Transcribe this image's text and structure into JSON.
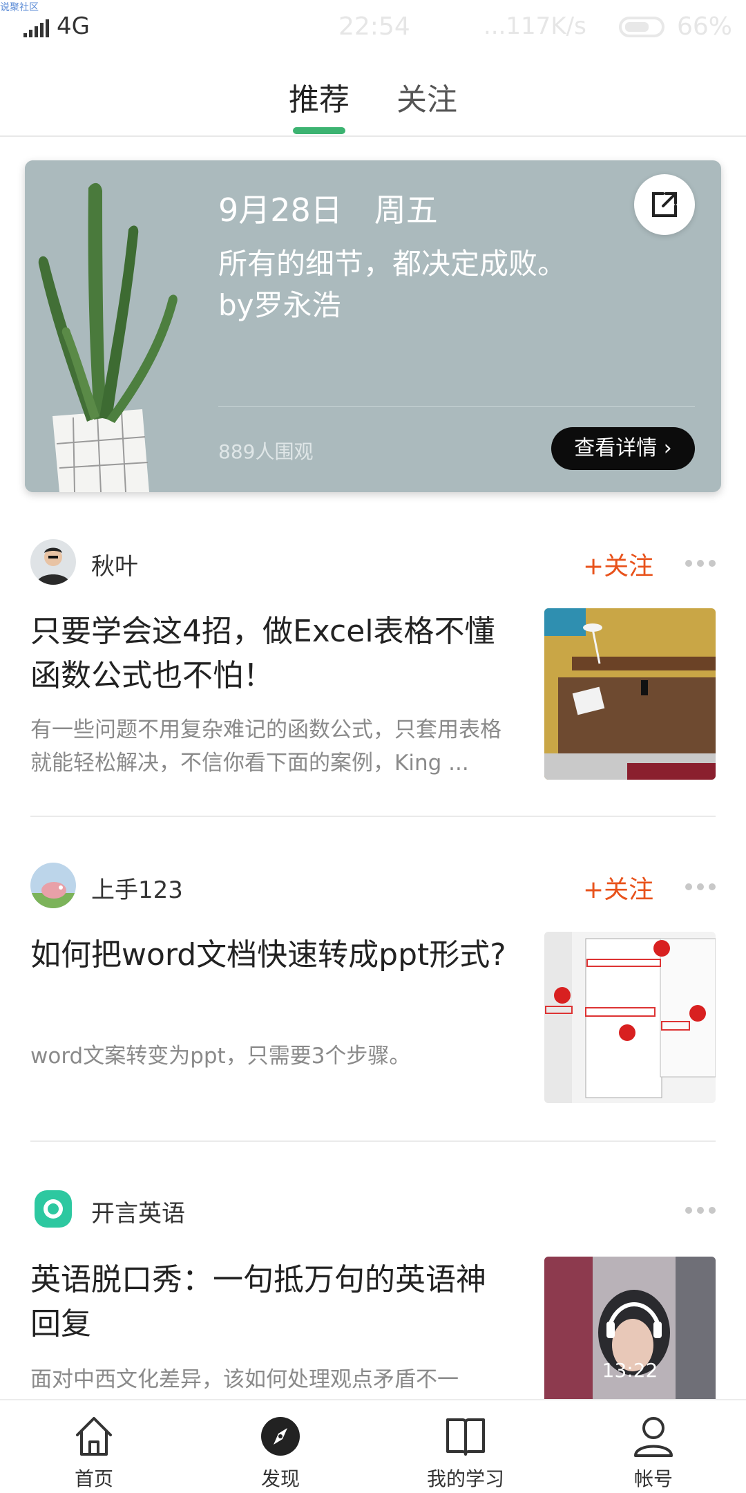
{
  "status_bar": {
    "watermark": "说聚社区",
    "network": "4G",
    "time": "22:54",
    "speed": "...117K/s",
    "battery": "66%",
    "battery_level": 0.66
  },
  "tabs": [
    {
      "label": "推荐",
      "active": true
    },
    {
      "label": "关注",
      "active": false
    }
  ],
  "quote_card": {
    "date": "9月28日　周五",
    "quote_line1": "所有的细节，都决定成败。",
    "quote_line2": "by罗永浩",
    "watchers": "889人围观",
    "detail_button": "查看详情",
    "background_color": "#abbabd"
  },
  "feed": [
    {
      "author": "秋叶",
      "follow_label": "+关注",
      "title": "只要学会这4招，做Excel表格不懂函数公式也不怕！",
      "summary": "有一些问题不用复杂难记的函数公式，只套用表格就能轻松解决，不信你看下面的案例，King ...",
      "thumbnail": "desk-photo"
    },
    {
      "author": "上手123",
      "follow_label": "+关注",
      "title": "如何把word文档快速转成ppt形式?",
      "summary": "word文案转变为ppt，只需要3个步骤。",
      "thumbnail": "screenshot-steps"
    },
    {
      "author": "开言英语",
      "title": "英语脱口秀：一句抵万句的英语神回复",
      "summary": "面对中西文化差异，该如何处理观点矛盾不一",
      "thumbnail": "audio-photo",
      "duration": "13:22"
    }
  ],
  "bottom_nav": [
    {
      "label": "首页",
      "icon": "home-icon"
    },
    {
      "label": "发现",
      "icon": "compass-icon",
      "active": true
    },
    {
      "label": "我的学习",
      "icon": "book-icon"
    },
    {
      "label": "帐号",
      "icon": "user-icon"
    }
  ],
  "colors": {
    "accent_green": "#3cb371",
    "follow_orange": "#e8521b"
  }
}
